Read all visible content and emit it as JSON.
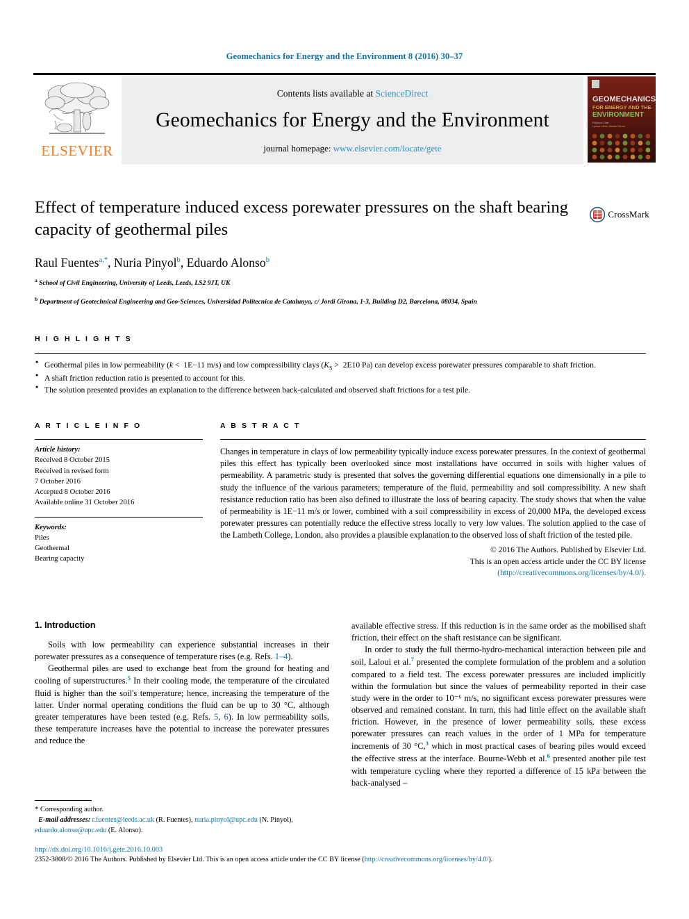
{
  "running_head": "Geomechanics for Energy and the Environment 8 (2016) 30–37",
  "masthead": {
    "publisher_name": "ELSEVIER",
    "contents_prefix": "Contents lists available at ",
    "contents_link": "ScienceDirect",
    "journal_name": "Geomechanics for Energy and the Environment",
    "homepage_prefix": "journal homepage: ",
    "homepage_url": "www.elsevier.com/locate/gete",
    "cover_title_line1": "GEOMECHANICS",
    "cover_title_line2": "FOR ENERGY AND THE",
    "cover_title_line3": "ENVIRONMENT"
  },
  "title": "Effect of temperature induced excess porewater pressures on the shaft bearing capacity of geothermal piles",
  "authors": [
    {
      "name": "Raul Fuentes",
      "marks": "a,*"
    },
    {
      "name": "Nuria Pinyol",
      "marks": "b"
    },
    {
      "name": "Eduardo Alonso",
      "marks": "b"
    }
  ],
  "affiliations": [
    {
      "mark": "a",
      "text": "School of Civil Engineering, University of Leeds, Leeds, LS2 9JT, UK"
    },
    {
      "mark": "b",
      "text": "Department of Geotechnical Engineering and Geo-Sciences, Universidad Politecnica de Catalunya, c/ Jordi Girona, 1-3, Building D2, Barcelona, 08034, Spain"
    }
  ],
  "crossmark_label": "CrossMark",
  "highlights": {
    "label": "H I G H L I G H T S",
    "items": [
      "Geothermal piles in low permeability (k < 1E−11 m/s) and low compressibility clays (KS > 2E10 Pa) can develop excess porewater pressures comparable to shaft friction.",
      "A shaft friction reduction ratio is presented to account for this.",
      "The solution presented provides an explanation to the difference between back-calculated and observed shaft frictions for a test pile."
    ]
  },
  "article_info": {
    "label": "A R T I C L E   I N F O",
    "history_label": "Article history:",
    "history": [
      "Received 8 October 2015",
      "Received in revised form",
      "7 October 2016",
      "Accepted 8 October 2016",
      "Available online 31 October 2016"
    ],
    "keywords_label": "Keywords:",
    "keywords": [
      "Piles",
      "Geothermal",
      "Bearing capacity"
    ]
  },
  "abstract": {
    "label": "A B S T R A C T",
    "text": "Changes in temperature in clays of low permeability typically induce excess porewater pressures. In the context of geothermal piles this effect has typically been overlooked since most installations have occurred in soils with higher values of permeability. A parametric study is presented that solves the governing differential equations one dimensionally in a pile to study the influence of the various parameters; temperature of the fluid, permeability and soil compressibility. A new shaft resistance reduction ratio has been also defined to illustrate the loss of bearing capacity. The study shows that when the value of permeability is 1E−11 m/s or lower, combined with a soil compressibility in excess of 20,000 MPa, the developed excess porewater pressures can potentially reduce the effective stress locally to very low values. The solution applied to the case of the Lambeth College, London, also provides a plausible explanation to the observed loss of shaft friction of the tested pile.",
    "copyright_line1": "© 2016 The Authors. Published by Elsevier Ltd.",
    "copyright_line2": "This is an open access article under the CC BY license",
    "copyright_link": "(http://creativecommons.org/licenses/by/4.0/)."
  },
  "body": {
    "section_heading": "1. Introduction",
    "left_paragraphs": [
      {
        "parts": [
          {
            "t": "Soils with low permeability can experience substantial increases in their porewater pressures as a consequence of temperature rises (e.g. Refs. "
          },
          {
            "t": "1–4",
            "style": "ref"
          },
          {
            "t": ")."
          }
        ]
      },
      {
        "parts": [
          {
            "t": "Geothermal piles are used to exchange heat from the ground for heating and cooling of superstructures."
          },
          {
            "t": "5",
            "style": "sup"
          },
          {
            "t": " In their cooling mode, the temperature of the circulated fluid is higher than the soil's temperature; hence, increasing the temperature of the latter. Under normal operating conditions the fluid can be up to 30 °C, although greater temperatures have been tested (e.g. Refs. "
          },
          {
            "t": "5",
            "style": "ref"
          },
          {
            "t": ", "
          },
          {
            "t": "6",
            "style": "ref"
          },
          {
            "t": "). In low permeability soils, these temperature increases have the potential to increase the porewater pressures and reduce the"
          }
        ]
      }
    ],
    "right_paragraphs": [
      {
        "parts": [
          {
            "t": "available effective stress. If this reduction is in the same order as the mobilised shaft friction, their effect on the shaft resistance can be significant."
          }
        ],
        "continuation": true
      },
      {
        "parts": [
          {
            "t": "In order to study the full thermo-hydro-mechanical interaction between pile and soil, Laloui et al."
          },
          {
            "t": "7",
            "style": "sup"
          },
          {
            "t": " presented the complete formulation of the problem and a solution compared to a field test. The excess porewater pressures are included implicitly within the formulation but since the values of permeability reported in their case study were in the order to 10⁻⁶ m/s, no significant excess porewater pressures were observed and remained constant. In turn, this had little effect on the available shaft friction. However, in the presence of lower permeability soils, these excess porewater pressures can reach values in the order of 1 MPa for temperature increments of 30 °C,"
          },
          {
            "t": "3",
            "style": "sup"
          },
          {
            "t": " which in most practical cases of bearing piles would exceed the effective stress at the interface. Bourne-Webb et al."
          },
          {
            "t": "6",
            "style": "sup"
          },
          {
            "t": " presented another pile test with temperature cycling where they reported a difference of 15 kPa between the back-analysed –"
          }
        ]
      }
    ]
  },
  "footnote": {
    "star": "*",
    "corresponding": "Corresponding author.",
    "email_label": "E-mail addresses:",
    "emails": [
      {
        "addr": "r.fuentes@leeds.ac.uk",
        "who": "(R. Fuentes)"
      },
      {
        "addr": "nuria.pinyol@upc.edu",
        "who": "(N. Pinyol)"
      },
      {
        "addr": "eduardo.alonso@upc.edu",
        "who": "(E. Alonso)"
      }
    ]
  },
  "legal": {
    "doi": "http://dx.doi.org/10.1016/j.gete.2016.10.003",
    "issn_line_pre": "2352-3808/© 2016 The Authors. Published by Elsevier Ltd. This is an open access article under the CC BY license (",
    "issn_link": "http://creativecommons.org/licenses/by/4.0/",
    "issn_line_post": ")."
  },
  "colors": {
    "link": "#0a72a8",
    "sciencedirect": "#2b91c6",
    "elsevier_orange": "#f47d20",
    "panel_gray": "#ededed"
  }
}
